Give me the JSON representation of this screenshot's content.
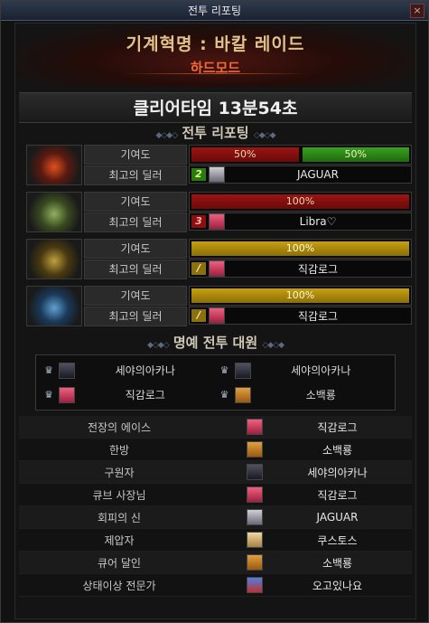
{
  "window": {
    "title": "전투 리포팅",
    "close_glyph": "×"
  },
  "hero": {
    "raid_title": "기계혁명 : 바칼 레이드",
    "difficulty": "하드모드"
  },
  "clear_time": "클리어타임  13분54초",
  "report_header": "전투 리포팅",
  "row_labels": {
    "contribution": "기여도",
    "top_dealer": "최고의 딜러"
  },
  "bosses": [
    {
      "icon": "red-mech-boss-icon",
      "bars": [
        {
          "color": "red",
          "pct": 50,
          "label": "50%"
        },
        {
          "color": "green",
          "pct": 50,
          "label": "50%"
        }
      ],
      "rank": "2",
      "rank_color": "green",
      "portrait": "silver-hair-portrait",
      "dealer": "JAGUAR"
    },
    {
      "icon": "green-mech-boss-icon",
      "bars": [
        {
          "color": "red",
          "pct": 100,
          "label": "100%"
        }
      ],
      "rank": "3",
      "rank_color": "red",
      "portrait": "pink-hair-portrait",
      "dealer": "Libra♡"
    },
    {
      "icon": "gold-mech-boss-icon",
      "bars": [
        {
          "color": "gold",
          "pct": 100,
          "label": "100%"
        }
      ],
      "rank": "/",
      "rank_color": "gold",
      "portrait": "pink-hair-portrait",
      "dealer": "직감로그"
    },
    {
      "icon": "blue-mech-boss-icon",
      "bars": [
        {
          "color": "gold",
          "pct": 100,
          "label": "100%"
        }
      ],
      "rank": "/",
      "rank_color": "gold",
      "portrait": "pink-hair-portrait",
      "dealer": "직감로그"
    }
  ],
  "honor_header": "명예 전투 대원",
  "honor_members": [
    {
      "name": "세야의아카나",
      "portrait": "dark-hair-portrait"
    },
    {
      "name": "세야의아카나",
      "portrait": "dark-hair-portrait"
    },
    {
      "name": "직감로그",
      "portrait": "pink-hair-portrait"
    },
    {
      "name": "소백룡",
      "portrait": "orange-box-portrait"
    }
  ],
  "awards": [
    {
      "title": "전장의 에이스",
      "portrait": "pink-hair-portrait",
      "player": "직감로그"
    },
    {
      "title": "한방",
      "portrait": "orange-box-portrait",
      "player": "소백룡"
    },
    {
      "title": "구원자",
      "portrait": "dark-hair-portrait",
      "player": "세야의아카나"
    },
    {
      "title": "큐브 사장님",
      "portrait": "pink-hair-portrait",
      "player": "직감로그"
    },
    {
      "title": "회피의 신",
      "portrait": "silver-hair-portrait",
      "player": "JAGUAR"
    },
    {
      "title": "제압자",
      "portrait": "blonde-hair-portrait",
      "player": "쿠스토스"
    },
    {
      "title": "큐어 달인",
      "portrait": "orange-box-portrait",
      "player": "소백룡"
    },
    {
      "title": "상태이상 전문가",
      "portrait": "blue-hair-portrait",
      "player": "오고있나요"
    }
  ],
  "colors": {
    "accent_red": "#9a1414",
    "accent_green": "#3aa020",
    "accent_gold": "#c8a010",
    "hard_mode": "#f26a3a"
  }
}
